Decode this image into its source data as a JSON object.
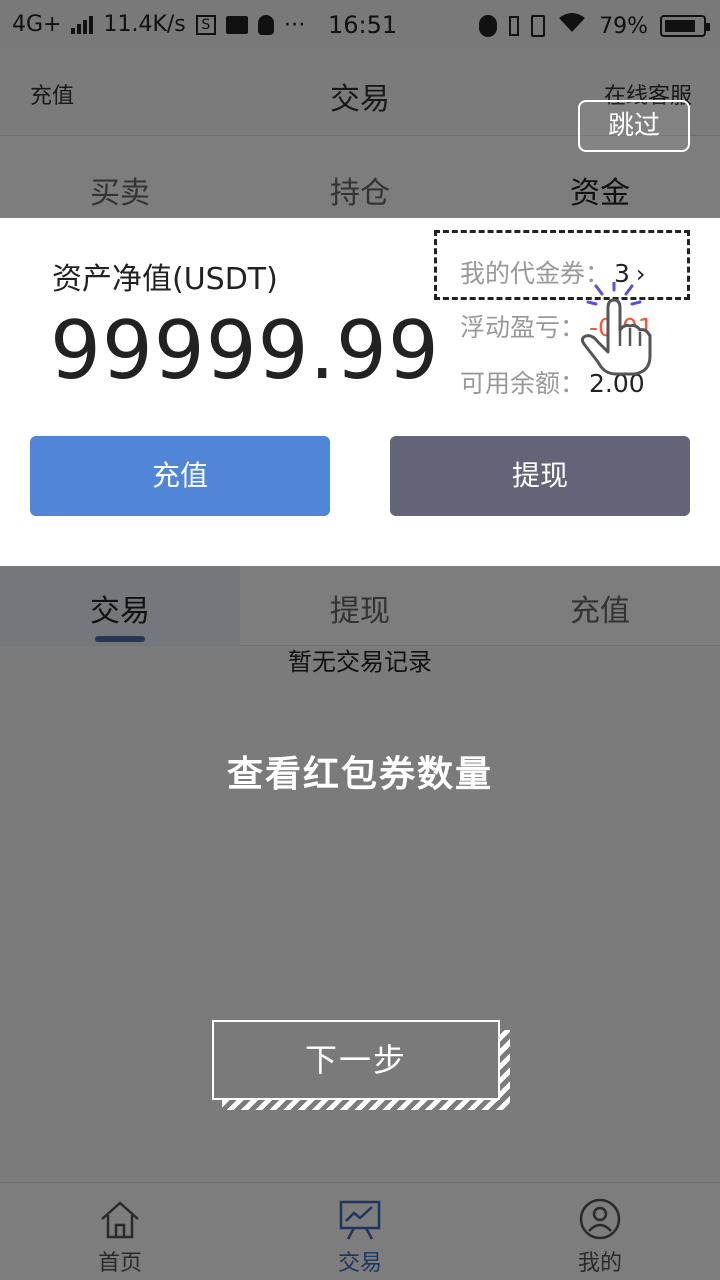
{
  "status_bar": {
    "network": "4G+",
    "speed": "11.4K/s",
    "time": "16:51",
    "battery": "79%",
    "icons": [
      "signal-icon",
      "s-app-icon",
      "photo-icon",
      "qq-icon",
      "more-dots-icon",
      "bluetooth-icon",
      "battery-small-icon",
      "vibrate-icon",
      "wifi-icon",
      "battery-icon"
    ]
  },
  "nav": {
    "left": "充值",
    "title": "交易",
    "right": "在线客服"
  },
  "top_tabs": [
    "买卖",
    "持仓",
    "资金"
  ],
  "asset": {
    "label": "资产净值(USDT)",
    "value": "99999.99",
    "voucher_label": "我的代金券：",
    "voucher_count": "3",
    "float_label": "浮动盈亏：",
    "float_value": "-0.01",
    "available_label": "可用余额：",
    "available_value": "2.00",
    "btn_recharge": "充值",
    "btn_withdraw": "提现"
  },
  "sub_tabs": [
    "交易",
    "提现",
    "充值"
  ],
  "empty_text": "暂无交易记录",
  "guide": {
    "skip": "跳过",
    "message": "查看红包券数量",
    "next": "下一步"
  },
  "bottom_nav": [
    "首页",
    "交易",
    "我的"
  ],
  "colors": {
    "primary": "#5085d8",
    "secondary": "#636477",
    "negative": "#f2593a",
    "tab_underline": "#4a6fa5"
  }
}
